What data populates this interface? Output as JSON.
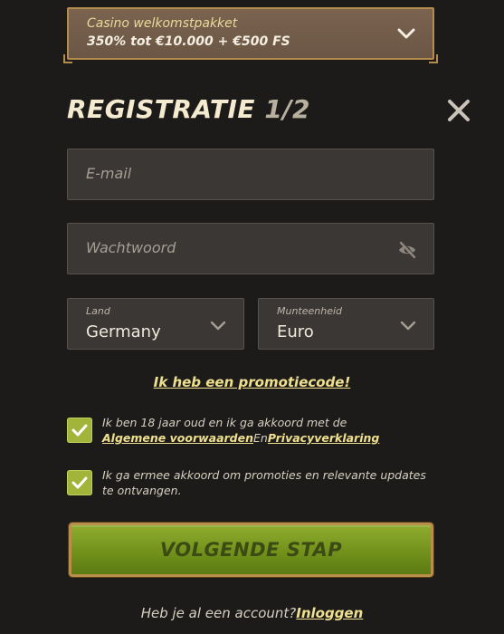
{
  "bonus": {
    "label": "Casino welkomstpakket",
    "value": "350% tot €10.000 + €500 FS",
    "chevron_icon": "chevron-down-icon"
  },
  "title": {
    "main": "REGISTRATIE",
    "step": "1/2"
  },
  "close_icon": "close-icon",
  "email": {
    "placeholder": "E-mail",
    "value": ""
  },
  "password": {
    "placeholder": "Wachtwoord",
    "value": "",
    "toggle_icon": "eye-off-icon"
  },
  "country": {
    "label": "Land",
    "value": "Germany"
  },
  "currency": {
    "label": "Munteenheid",
    "value": "Euro"
  },
  "promo_link": "Ik heb een promotiecode!",
  "terms": {
    "checked": true,
    "text": "Ik ben 18 jaar oud en ik ga akkoord met de",
    "link1": "Algemene voorwaarden",
    "conj": "En",
    "link2": "Privacyverklaring"
  },
  "promotions": {
    "checked": true,
    "text": "Ik ga ermee akkoord om promoties en relevante updates te ontvangen."
  },
  "next_button": "VOLGENDE STAP",
  "login": {
    "prompt": "Heb je al een account?",
    "link": "Inloggen"
  },
  "colors": {
    "background": "#1c1b19",
    "accent_yellow": "#efe08f",
    "button_green": "#7e9d24",
    "checkbox_green": "#a2b53a",
    "gold_border": "#b48c4e"
  }
}
